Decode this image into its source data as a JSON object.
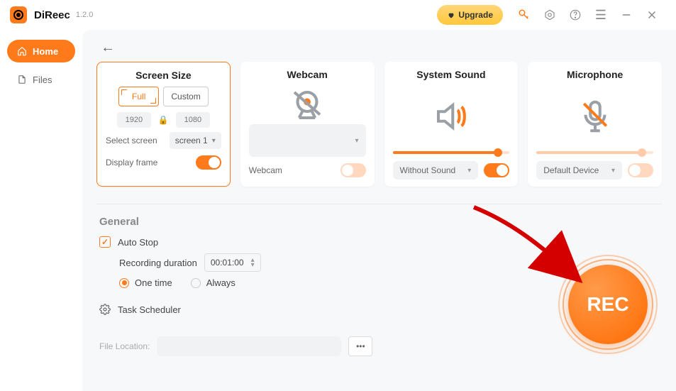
{
  "app": {
    "name": "DiReec",
    "version": "1.2.0"
  },
  "titlebar": {
    "upgrade": "Upgrade"
  },
  "sidebar": {
    "home": "Home",
    "files": "Files"
  },
  "cards": {
    "screen": {
      "title": "Screen Size",
      "full": "Full",
      "custom": "Custom",
      "width": "1920",
      "height": "1080",
      "select_label": "Select screen",
      "screen_value": "screen 1",
      "display_frame": "Display frame"
    },
    "webcam": {
      "title": "Webcam",
      "label": "Webcam",
      "select_value": ""
    },
    "sound": {
      "title": "System Sound",
      "select_value": "Without Sound",
      "level_pct": 90
    },
    "mic": {
      "title": "Microphone",
      "select_value": "Default Device",
      "level_pct": 90
    }
  },
  "general": {
    "heading": "General",
    "autostop": "Auto Stop",
    "duration_label": "Recording duration",
    "duration_value": "00:01:00",
    "one_time": "One time",
    "always": "Always",
    "task_scheduler": "Task Scheduler",
    "file_location_label": "File Location:"
  },
  "rec": {
    "label": "REC"
  }
}
